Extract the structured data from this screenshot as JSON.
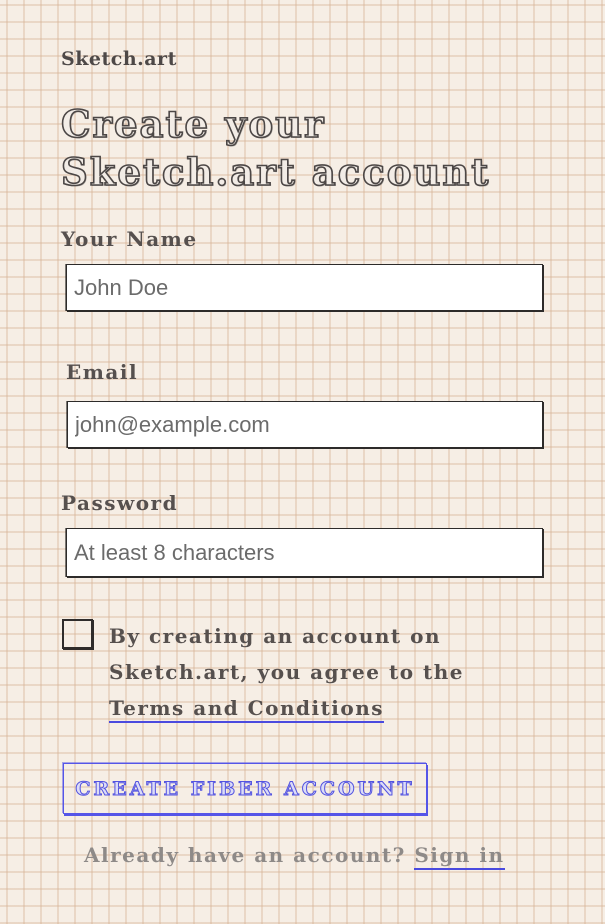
{
  "brand": "Sketch.art",
  "heading": {
    "line1": "Create your",
    "line2": "Sketch.art account"
  },
  "form": {
    "name": {
      "label": "Your Name",
      "placeholder": "John Doe"
    },
    "email": {
      "label": "Email",
      "placeholder": "john@example.com"
    },
    "password": {
      "label": "Password",
      "placeholder": "At least 8 characters"
    },
    "terms": {
      "checked": false,
      "text_before": "By creating an account on Sketch.art, you agree to the",
      "link_text": "Terms and Conditions"
    },
    "submit_label": "CREATE FIBER ACCOUNT"
  },
  "footer": {
    "prompt": "Already have an account?",
    "signin_label": "Sign in"
  },
  "colors": {
    "background": "#f6eee5",
    "grid_line": "#d6b294",
    "accent_blue": "#5555e8",
    "ink": "#4a4645"
  }
}
